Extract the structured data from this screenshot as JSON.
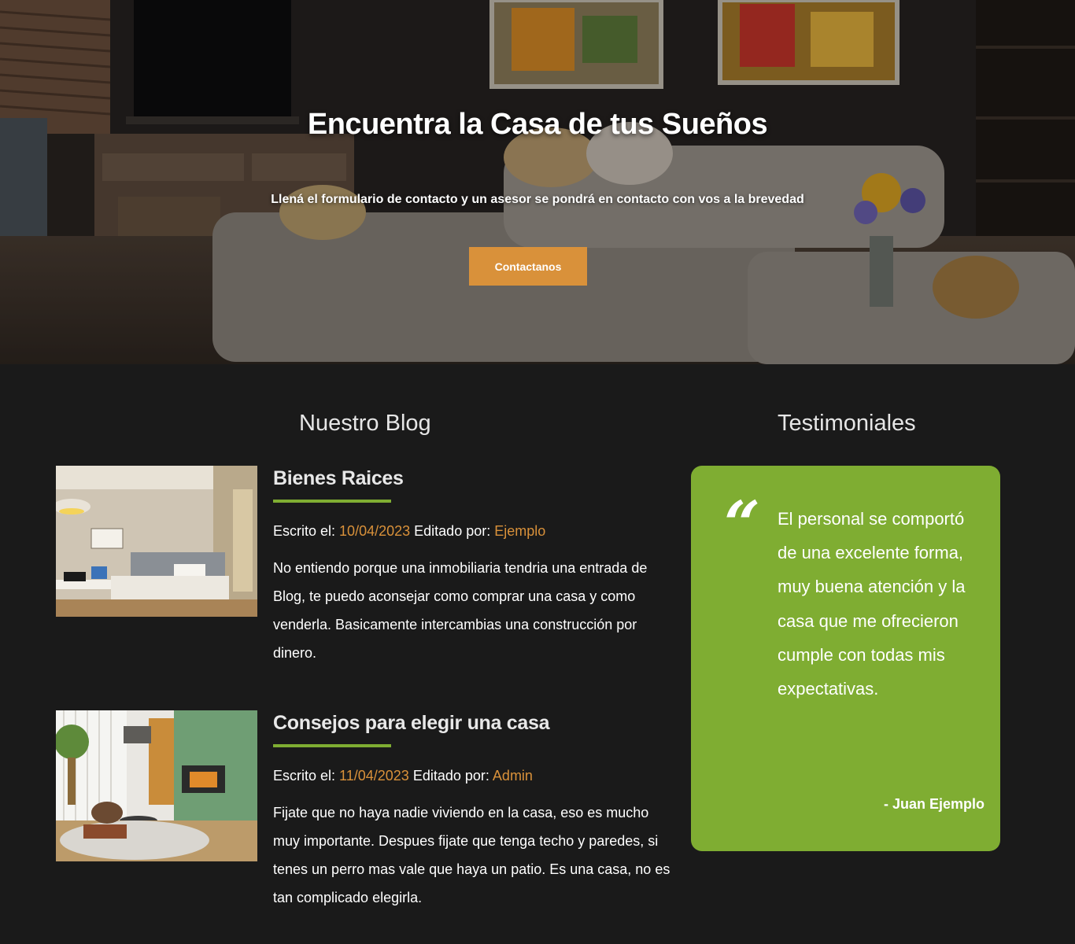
{
  "hero": {
    "title": "Encuentra la Casa de tus Sueños",
    "subtitle": "Llená el formulario de contacto y un asesor se pondrá en contacto con vos a la brevedad",
    "cta_label": "Contactanos"
  },
  "blog": {
    "section_title": "Nuestro Blog",
    "posts": [
      {
        "title": "Bienes Raices",
        "written_label": "Escrito el:",
        "date": "10/04/2023",
        "edited_label": "Editado por:",
        "author": "Ejemplo",
        "text": "No entiendo porque una inmobiliaria tendria una entrada de Blog, te puedo aconsejar como comprar una casa y como venderla. Basicamente intercambias una construcción por dinero."
      },
      {
        "title": "Consejos para elegir una casa",
        "written_label": "Escrito el:",
        "date": "11/04/2023",
        "edited_label": "Editado por:",
        "author": "Admin",
        "text": "Fijate que no haya nadie viviendo en la casa, eso es mucho muy importante. Despues fijate que tenga techo y paredes, si tenes un perro mas vale que haya un patio. Es una casa, no es tan complicado elegirla."
      }
    ]
  },
  "testimonials": {
    "section_title": "Testimoniales",
    "quote_mark": "“",
    "text": "El personal se comportó de una excelente forma, muy buena atención y la casa que me ofrecieron cumple con todas mis expectativas.",
    "author": "- Juan Ejemplo"
  },
  "colors": {
    "accent_orange": "#d9913a",
    "accent_green": "#7fad32",
    "background": "#1a1a1a"
  }
}
